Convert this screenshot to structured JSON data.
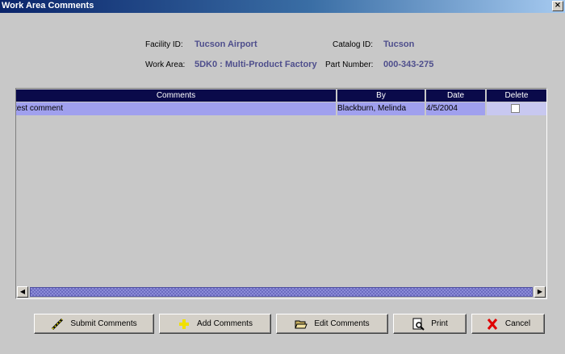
{
  "window": {
    "title": "Work Area Comments",
    "close_glyph": "×"
  },
  "info": {
    "facility_label": "Facility ID:",
    "facility_value": "Tucson Airport",
    "catalog_label": "Catalog ID:",
    "catalog_value": "Tucson",
    "workarea_label": "Work Area:",
    "workarea_value": "5DK0 : Multi-Product Factory",
    "part_label": "Part Number:",
    "part_value": "000-343-275"
  },
  "table": {
    "columns": [
      "Comments",
      "By",
      "Date",
      "Delete"
    ],
    "rows": [
      {
        "comment": "test comment",
        "by": "Blackburn, Melinda",
        "date": "4/5/2004",
        "delete": false
      }
    ]
  },
  "scrollbar": {
    "left_glyph": "◀",
    "right_glyph": "▶"
  },
  "buttons": {
    "submit": "Submit Comments",
    "add": "Add Comments",
    "edit": "Edit Comments",
    "print": "Print",
    "cancel": "Cancel"
  },
  "colors": {
    "header_bg": "#0a0a4a",
    "row_bg": "#a0a0ee",
    "value_text": "#4e4e8c",
    "cancel_x": "#e00000"
  },
  "icons": [
    "close-icon",
    "pencil-icon",
    "plus-icon",
    "folder-open-icon",
    "print-preview-icon",
    "red-x-icon"
  ]
}
